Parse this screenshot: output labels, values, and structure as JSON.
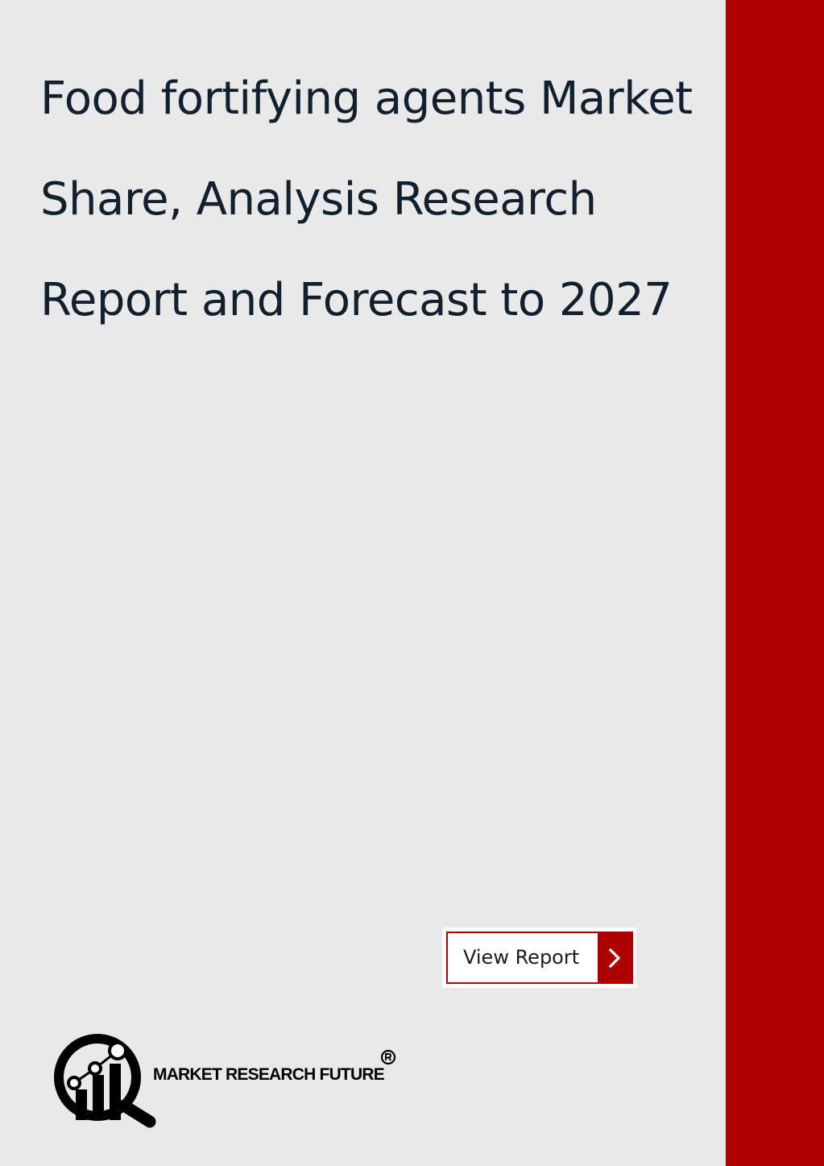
{
  "document": {
    "title_lines": [
      "Food fortifying agents Market",
      "Share, Analysis Research",
      "Report and Forecast to 2027"
    ]
  },
  "cta": {
    "label": "View Report",
    "icon": "chevron-right-icon"
  },
  "brand": {
    "name": "MARKET RESEARCH FUTURE",
    "registered_mark": "®",
    "logo_icon": "magnifier-chart-icon"
  },
  "colors": {
    "background": "#e9e9e9",
    "accent": "#ae0000",
    "title_text": "#11202e"
  }
}
